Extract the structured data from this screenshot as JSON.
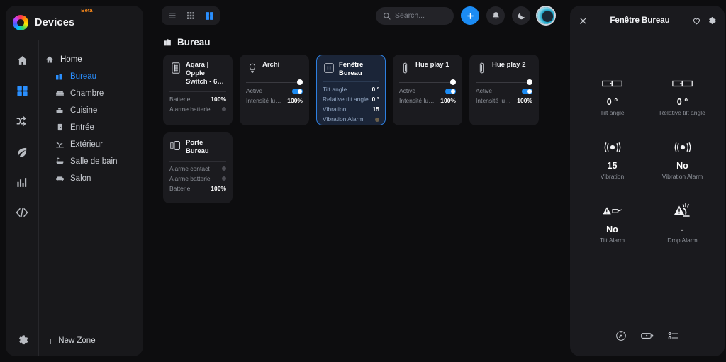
{
  "brand": {
    "name": "Devices",
    "badge": "Beta",
    "logo_icon": "color-ring-logo-icon"
  },
  "rail": [
    {
      "name": "home",
      "icon": "home-icon",
      "active": false
    },
    {
      "name": "devices",
      "icon": "grid-squares-icon",
      "active": true
    },
    {
      "name": "automations",
      "icon": "shuffle-arrows-icon",
      "active": false
    },
    {
      "name": "energy",
      "icon": "leaf-icon",
      "active": false
    },
    {
      "name": "statistics",
      "icon": "bar-chart-icon",
      "active": false
    },
    {
      "name": "developer",
      "icon": "code-brackets-icon",
      "active": false
    }
  ],
  "zones": [
    {
      "label": "Home",
      "icon": "home-icon",
      "level": "root",
      "active": false
    },
    {
      "label": "Bureau",
      "icon": "office-building-icon",
      "level": "child",
      "active": true
    },
    {
      "label": "Chambre",
      "icon": "bed-icon",
      "level": "child",
      "active": false
    },
    {
      "label": "Cuisine",
      "icon": "pot-icon",
      "level": "child",
      "active": false
    },
    {
      "label": "Entrée",
      "icon": "door-icon",
      "level": "child",
      "active": false
    },
    {
      "label": "Extérieur",
      "icon": "outdoor-plant-icon",
      "level": "child",
      "active": false
    },
    {
      "label": "Salle de bain",
      "icon": "bathtub-icon",
      "level": "child",
      "active": false
    },
    {
      "label": "Salon",
      "icon": "sofa-icon",
      "level": "child",
      "active": false
    }
  ],
  "sidebar_footer": {
    "settings_icon": "gear-icon",
    "new_zone_label": "New Zone",
    "plus": "+"
  },
  "toolbar": {
    "views": [
      {
        "name": "list-view",
        "icon": "list-lines-icon",
        "active": false
      },
      {
        "name": "compact-grid-view",
        "icon": "dense-grid-icon",
        "active": false
      },
      {
        "name": "card-grid-view",
        "icon": "large-grid-icon",
        "active": true
      }
    ],
    "search": {
      "placeholder": "Search...",
      "value": "",
      "icon": "search-icon"
    },
    "add_label": "+",
    "notifications_icon": "bell-icon",
    "theme_icon": "moon-icon",
    "avatar_name": "user-avatar"
  },
  "zone_header": {
    "title": "Bureau",
    "icon": "office-building-icon"
  },
  "cards": [
    {
      "title": "Aqara | Opple Switch - 6…",
      "icon": "wall-switch-icon",
      "selected": false,
      "has_slider": false,
      "props": [
        {
          "name": "Batterie",
          "value": "100%",
          "type": "text"
        },
        {
          "name": "Alarme batterie",
          "value": "",
          "type": "dot"
        }
      ]
    },
    {
      "title": "Archi",
      "icon": "bulb-icon",
      "selected": false,
      "has_slider": true,
      "props": [
        {
          "name": "Activé",
          "value": "",
          "type": "toggle"
        },
        {
          "name": "Intensité lumineu…",
          "value": "100%",
          "type": "text"
        }
      ]
    },
    {
      "title": "Fenêtre Bureau",
      "icon": "window-sensor-icon",
      "selected": true,
      "has_slider": false,
      "props": [
        {
          "name": "Tilt angle",
          "value": "0 °",
          "type": "text"
        },
        {
          "name": "Relative tilt angle",
          "value": "0 °",
          "type": "text"
        },
        {
          "name": "Vibration",
          "value": "15",
          "type": "text"
        },
        {
          "name": "Vibration Alarm",
          "value": "",
          "type": "dot"
        }
      ]
    },
    {
      "title": "Hue play 1",
      "icon": "light-bar-icon",
      "selected": false,
      "has_slider": true,
      "props": [
        {
          "name": "Activé",
          "value": "",
          "type": "toggle"
        },
        {
          "name": "Intensité lumineu…",
          "value": "100%",
          "type": "text"
        }
      ]
    },
    {
      "title": "Hue play 2",
      "icon": "light-bar-icon",
      "selected": false,
      "has_slider": true,
      "props": [
        {
          "name": "Activé",
          "value": "",
          "type": "toggle"
        },
        {
          "name": "Intensité lumineu…",
          "value": "100%",
          "type": "text"
        }
      ]
    },
    {
      "title": "Porte Bureau",
      "icon": "door-sensor-icon",
      "selected": false,
      "has_slider": false,
      "props": [
        {
          "name": "Alarme contact",
          "value": "",
          "type": "dot"
        },
        {
          "name": "Alarme batterie",
          "value": "",
          "type": "dot"
        },
        {
          "name": "Batterie",
          "value": "100%",
          "type": "text"
        }
      ]
    }
  ],
  "panel": {
    "title": "Fenêtre Bureau",
    "close_icon": "close-icon",
    "favorite_icon": "heart-icon",
    "settings_icon": "gear-icon",
    "stats": [
      {
        "value": "0 °",
        "label": "Tilt angle",
        "icon": "tilt-angle-icon"
      },
      {
        "value": "0 °",
        "label": "Relative tilt angle",
        "icon": "tilt-angle-icon"
      },
      {
        "value": "15",
        "label": "Vibration",
        "icon": "vibration-icon"
      },
      {
        "value": "No",
        "label": "Vibration Alarm",
        "icon": "vibration-icon"
      },
      {
        "value": "No",
        "label": "Tilt Alarm",
        "icon": "tilt-alarm-icon"
      },
      {
        "value": "-",
        "label": "Drop Alarm",
        "icon": "drop-alarm-icon"
      }
    ],
    "footer_icons": [
      {
        "name": "gauge-icon"
      },
      {
        "name": "battery-icon"
      },
      {
        "name": "options-list-icon"
      }
    ]
  },
  "colors": {
    "accent": "#1b8cf5",
    "selected_card_bg": "#1b2538",
    "selected_card_border": "#2d7fe0",
    "beta_badge": "#ff8c1a"
  }
}
